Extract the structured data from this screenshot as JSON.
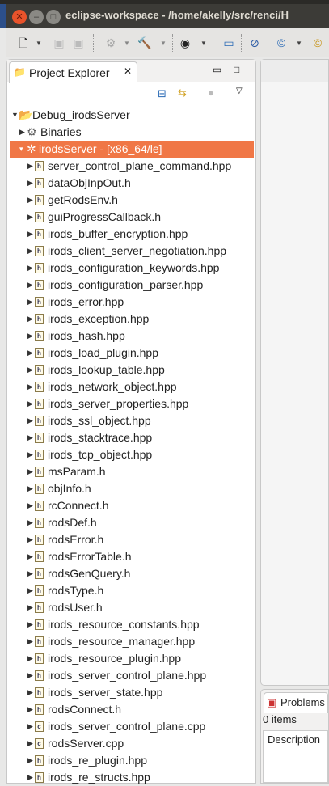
{
  "window": {
    "title": "eclipse-workspace - /home/akelly/src/renci/H"
  },
  "explorer": {
    "tab_label": "Project Explorer",
    "tree": {
      "project": "Debug_irodsServer",
      "binaries": "Binaries",
      "binary_selected": "irodsServer - [x86_64/le]",
      "files": [
        {
          "name": "server_control_plane_command.hpp",
          "type": "h"
        },
        {
          "name": "dataObjInpOut.h",
          "type": "h"
        },
        {
          "name": "getRodsEnv.h",
          "type": "h"
        },
        {
          "name": "guiProgressCallback.h",
          "type": "h"
        },
        {
          "name": "irods_buffer_encryption.hpp",
          "type": "h"
        },
        {
          "name": "irods_client_server_negotiation.hpp",
          "type": "h"
        },
        {
          "name": "irods_configuration_keywords.hpp",
          "type": "h"
        },
        {
          "name": "irods_configuration_parser.hpp",
          "type": "h"
        },
        {
          "name": "irods_error.hpp",
          "type": "h"
        },
        {
          "name": "irods_exception.hpp",
          "type": "h"
        },
        {
          "name": "irods_hash.hpp",
          "type": "h"
        },
        {
          "name": "irods_load_plugin.hpp",
          "type": "h"
        },
        {
          "name": "irods_lookup_table.hpp",
          "type": "h"
        },
        {
          "name": "irods_network_object.hpp",
          "type": "h"
        },
        {
          "name": "irods_server_properties.hpp",
          "type": "h"
        },
        {
          "name": "irods_ssl_object.hpp",
          "type": "h"
        },
        {
          "name": "irods_stacktrace.hpp",
          "type": "h"
        },
        {
          "name": "irods_tcp_object.hpp",
          "type": "h"
        },
        {
          "name": "msParam.h",
          "type": "h"
        },
        {
          "name": "objInfo.h",
          "type": "h"
        },
        {
          "name": "rcConnect.h",
          "type": "h"
        },
        {
          "name": "rodsDef.h",
          "type": "h"
        },
        {
          "name": "rodsError.h",
          "type": "h"
        },
        {
          "name": "rodsErrorTable.h",
          "type": "h"
        },
        {
          "name": "rodsGenQuery.h",
          "type": "h"
        },
        {
          "name": "rodsType.h",
          "type": "h"
        },
        {
          "name": "rodsUser.h",
          "type": "h"
        },
        {
          "name": "irods_resource_constants.hpp",
          "type": "h"
        },
        {
          "name": "irods_resource_manager.hpp",
          "type": "h"
        },
        {
          "name": "irods_resource_plugin.hpp",
          "type": "h"
        },
        {
          "name": "irods_server_control_plane.hpp",
          "type": "h"
        },
        {
          "name": "irods_server_state.hpp",
          "type": "h"
        },
        {
          "name": "rodsConnect.h",
          "type": "h"
        },
        {
          "name": "irods_server_control_plane.cpp",
          "type": "c"
        },
        {
          "name": "rodsServer.cpp",
          "type": "c"
        },
        {
          "name": "irods_re_plugin.hpp",
          "type": "h"
        },
        {
          "name": "irods_re_structs.hpp",
          "type": "h"
        }
      ]
    }
  },
  "problems": {
    "tab_label": "Problems",
    "count": "0 items",
    "column": "Description"
  },
  "colors": {
    "selection": "#f07746",
    "titlebar": "#3c3b37"
  }
}
